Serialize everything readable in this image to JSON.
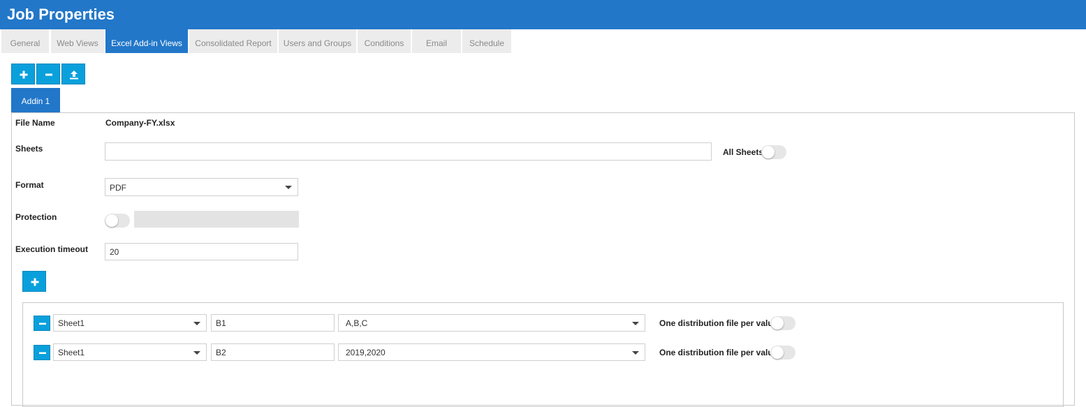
{
  "window": {
    "title": "Job Properties"
  },
  "tabs": [
    {
      "label": "General",
      "active": false
    },
    {
      "label": "Web Views",
      "active": false
    },
    {
      "label": "Excel Add-in Views",
      "active": true
    },
    {
      "label": "Consolidated Report",
      "active": false
    },
    {
      "label": "Users and Groups",
      "active": false
    },
    {
      "label": "Conditions",
      "active": false
    },
    {
      "label": "Email",
      "active": false
    },
    {
      "label": "Schedule",
      "active": false
    }
  ],
  "toolbar": {
    "add_icon": "plus-icon",
    "remove_icon": "minus-icon",
    "upload_icon": "upload-icon"
  },
  "addin_tabs": [
    {
      "label": "Addin 1",
      "active": true
    }
  ],
  "form": {
    "file_name": {
      "label": "File Name",
      "value": "Company-FY.xlsx"
    },
    "sheets": {
      "label": "Sheets",
      "value": "",
      "all_sheets_label": "All Sheets",
      "all_sheets_on": false
    },
    "format": {
      "label": "Format",
      "value": "PDF"
    },
    "protection": {
      "label": "Protection",
      "on": false,
      "password": ""
    },
    "execution_timeout": {
      "label": "Execution timeout",
      "value": "20"
    }
  },
  "distribution": {
    "add_icon": "plus-icon",
    "rows": [
      {
        "sheet": "Sheet1",
        "cell": "B1",
        "values": "A,B,C",
        "toggle_label": "One distribution file per value",
        "toggle_on": false
      },
      {
        "sheet": "Sheet1",
        "cell": "B2",
        "values": "2019,2020",
        "toggle_label": "One distribution file per value",
        "toggle_on": false
      }
    ]
  },
  "colors": {
    "header_blue": "#2277c9",
    "button_cyan": "#0aa0dc",
    "inactive_tab": "#ececec"
  }
}
